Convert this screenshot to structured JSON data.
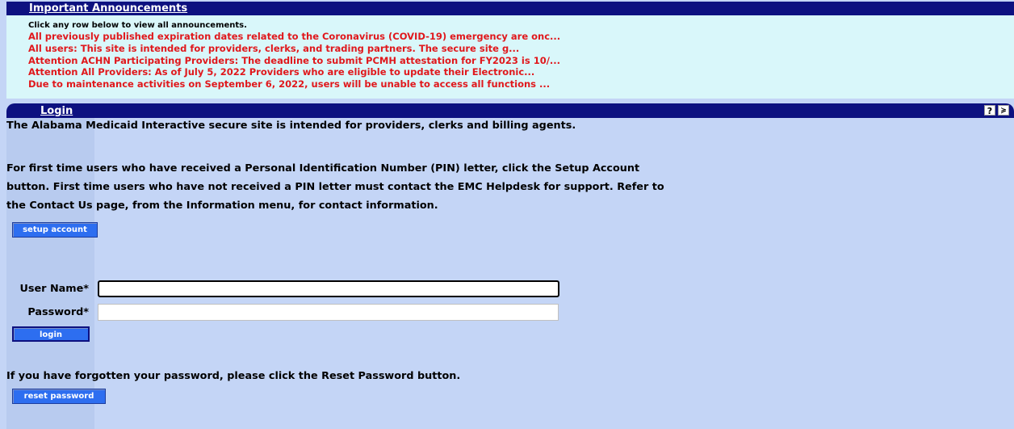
{
  "announcements": {
    "title": "Important Announcements",
    "hint": "Click any row below to view all announcements.",
    "items": [
      "All previously published expiration dates related to the Coronavirus (COVID-19) emergency are onc...",
      "All users: This site is intended for providers, clerks, and trading partners. The secure site g...",
      "Attention ACHN Participating Providers: The deadline to submit PCMH attestation for FY2023 is 10/...",
      "Attention All Providers: As of July 5, 2022 Providers who are eligible to update their Electronic...",
      "Due to maintenance activities on September 6, 2022, users will be unable to access all functions ..."
    ]
  },
  "login": {
    "title": "Login",
    "help_label": "?",
    "collapse_label": "≽",
    "intro": "The Alabama Medicaid Interactive secure site is intended for providers, clerks and billing agents.",
    "first_time_line1": "For first time users who have received a Personal Identification Number (PIN) letter, click the Setup Account",
    "first_time_line2": "button. First time users who have not received a PIN letter must contact the EMC Helpdesk for support. Refer to",
    "first_time_line3": "the Contact Us page, from the Information menu, for contact information.",
    "setup_button": "setup account",
    "username_label": "User Name*",
    "username_value": "",
    "password_label": "Password*",
    "password_value": "",
    "login_button": "login",
    "forgot_text": "If you have forgotten your password, please click the Reset Password button.",
    "reset_button": "reset password"
  }
}
